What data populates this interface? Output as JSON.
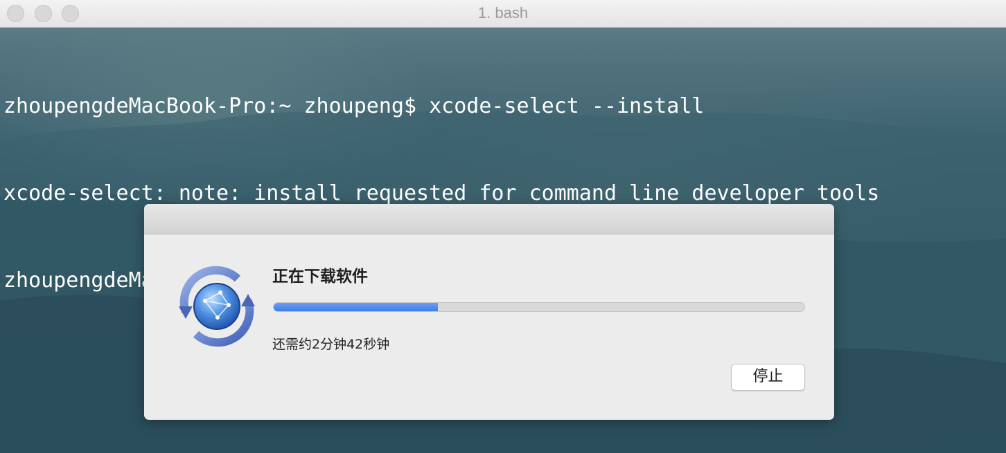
{
  "window": {
    "title": "1. bash"
  },
  "terminal": {
    "lines": [
      "zhoupengdeMacBook-Pro:~ zhoupeng$ xcode-select --install",
      "xcode-select: note: install requested for command line developer tools",
      "zhoupengdeMacBook-Pro:~ zhoupeng$"
    ]
  },
  "dialog": {
    "heading": "正在下载软件",
    "progress_fraction": 0.31,
    "remaining_text": "还需约2分钟42秒钟",
    "stop_label": "停止",
    "icon": "software-update-icon"
  },
  "colors": {
    "progress_fill": "#3f7ee8",
    "dialog_background": "#ececec"
  }
}
